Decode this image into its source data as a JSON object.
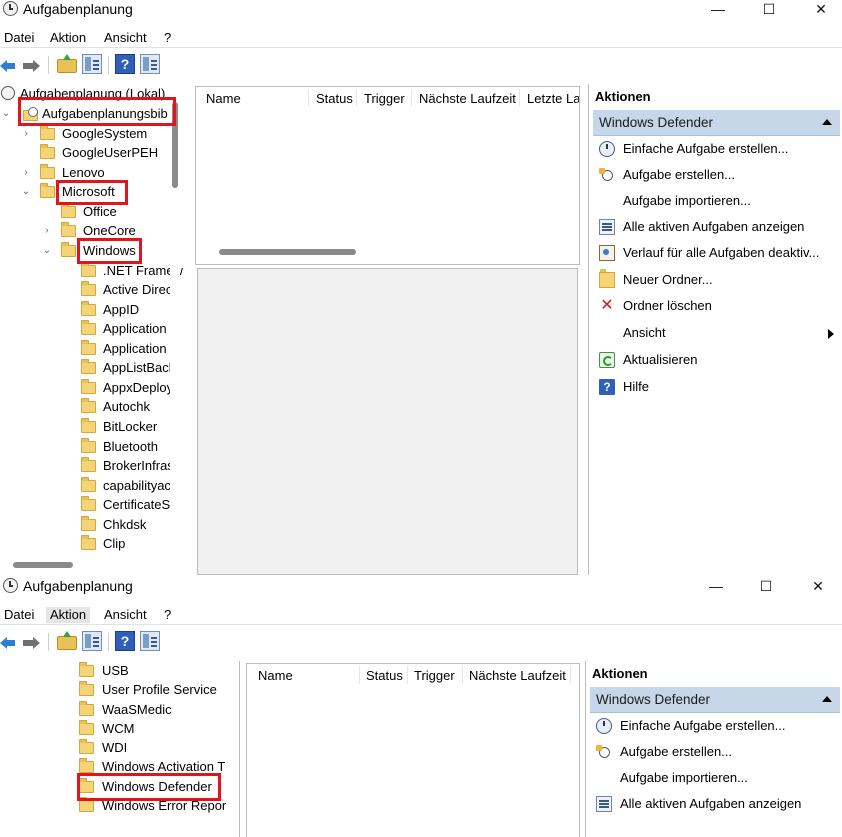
{
  "window1": {
    "title": "Aufgabenplanung",
    "controls": {
      "minimize": "—",
      "maximize": "☐",
      "close": "✕"
    },
    "menu": [
      "Datei",
      "Aktion",
      "Ansicht",
      "?"
    ],
    "tree": {
      "root": "Aufgabenplanung (Lokal)",
      "items": [
        "Aufgabenplanungsbib",
        "GoogleSystem",
        "GoogleUserPEH",
        "Lenovo",
        "Microsoft",
        "Office",
        "OneCore",
        "Windows",
        ".NET Framew",
        "Active Direc",
        "AppID",
        "Application",
        "Application",
        "AppListBack",
        "AppxDeploy",
        "Autochk",
        "BitLocker",
        "Bluetooth",
        "BrokerInfras",
        "capabilityac",
        "CertificateS",
        "Chkdsk",
        "Clip"
      ]
    },
    "columns": [
      "Name",
      "Status",
      "Trigger",
      "Nächste Laufzeit",
      "Letzte Lau"
    ],
    "actions": {
      "title": "Aktionen",
      "section": "Windows Defender",
      "items": [
        "Einfache Aufgabe erstellen...",
        "Aufgabe erstellen...",
        "Aufgabe importieren...",
        "Alle aktiven Aufgaben anzeigen",
        "Verlauf für alle Aufgaben deaktiv...",
        "Neuer Ordner...",
        "Ordner löschen",
        "Ansicht",
        "Aktualisieren",
        "Hilfe"
      ],
      "delete_glyph": "✕",
      "help_glyph": "?"
    }
  },
  "window2": {
    "title": "Aufgabenplanung",
    "controls": {
      "minimize": "—",
      "maximize": "☐",
      "close": "✕"
    },
    "menu": [
      "Datei",
      "Aktion",
      "Ansicht",
      "?"
    ],
    "tree": {
      "items": [
        "USB",
        "User Profile Service",
        "WaaSMedic",
        "WCM",
        "WDI",
        "Windows Activation T",
        "Windows Defender",
        "Windows Error Repor"
      ]
    },
    "columns": [
      "Name",
      "Status",
      "Trigger",
      "Nächste Laufzeit"
    ],
    "actions": {
      "title": "Aktionen",
      "section": "Windows Defender",
      "items": [
        "Einfache Aufgabe erstellen...",
        "Aufgabe erstellen...",
        "Aufgabe importieren...",
        "Alle aktiven Aufgaben anzeigen"
      ]
    },
    "toolbar_help_glyph": "?"
  },
  "colors": {
    "highlight": "#e0161f",
    "actions_header": "#c6d7ea",
    "pane_border": "#bdbdbd",
    "folder": "#f5d478"
  }
}
